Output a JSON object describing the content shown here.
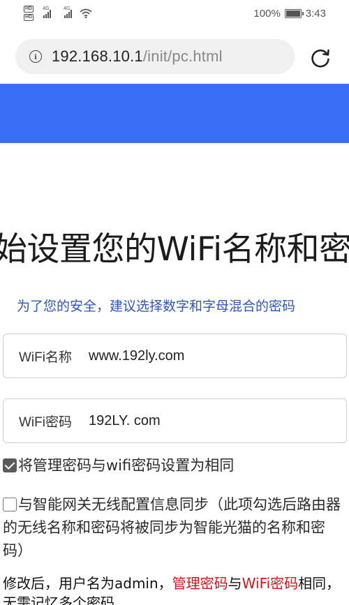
{
  "status_bar": {
    "battery_percent": "100%",
    "time": "3:43",
    "network_tag_1": "4G",
    "network_tag_2": "4G",
    "hd_1": "HD",
    "hd_2": "HD",
    "battery_level": 1.0
  },
  "address_bar": {
    "url_host": "192.168.10.1",
    "url_path": "/init/pc.html",
    "info_icon": "info-circle-icon",
    "reload_icon": "reload-icon"
  },
  "colors": {
    "banner": "#3a6ef5",
    "subtitle": "#2f56b6",
    "highlight": "#d01616"
  },
  "page": {
    "title": "始设置您的WiFi名称和密",
    "subtitle": "为了您的安全，建议选择数字和字母混合的密码",
    "wifi_name_label": "WiFi名称",
    "wifi_name_value": "www.192ly.com",
    "wifi_password_label": "WiFi密码",
    "wifi_password_value": "192LY. com",
    "same_password_checkbox": {
      "checked": true,
      "label": "将管理密码与wifi密码设置为相同"
    },
    "sync_checkbox": {
      "checked": false,
      "label": "与智能网关无线配置信息同步（此项勾选后路由器的无线名称和密码将被同步为智能光猫的名称和密码）"
    },
    "note": {
      "part1": "修改后，用户名为admin，",
      "part2": "管理密码",
      "part3": "与",
      "part4": "WiFi密码",
      "part5": "相同，无需记忆多个密码"
    }
  }
}
